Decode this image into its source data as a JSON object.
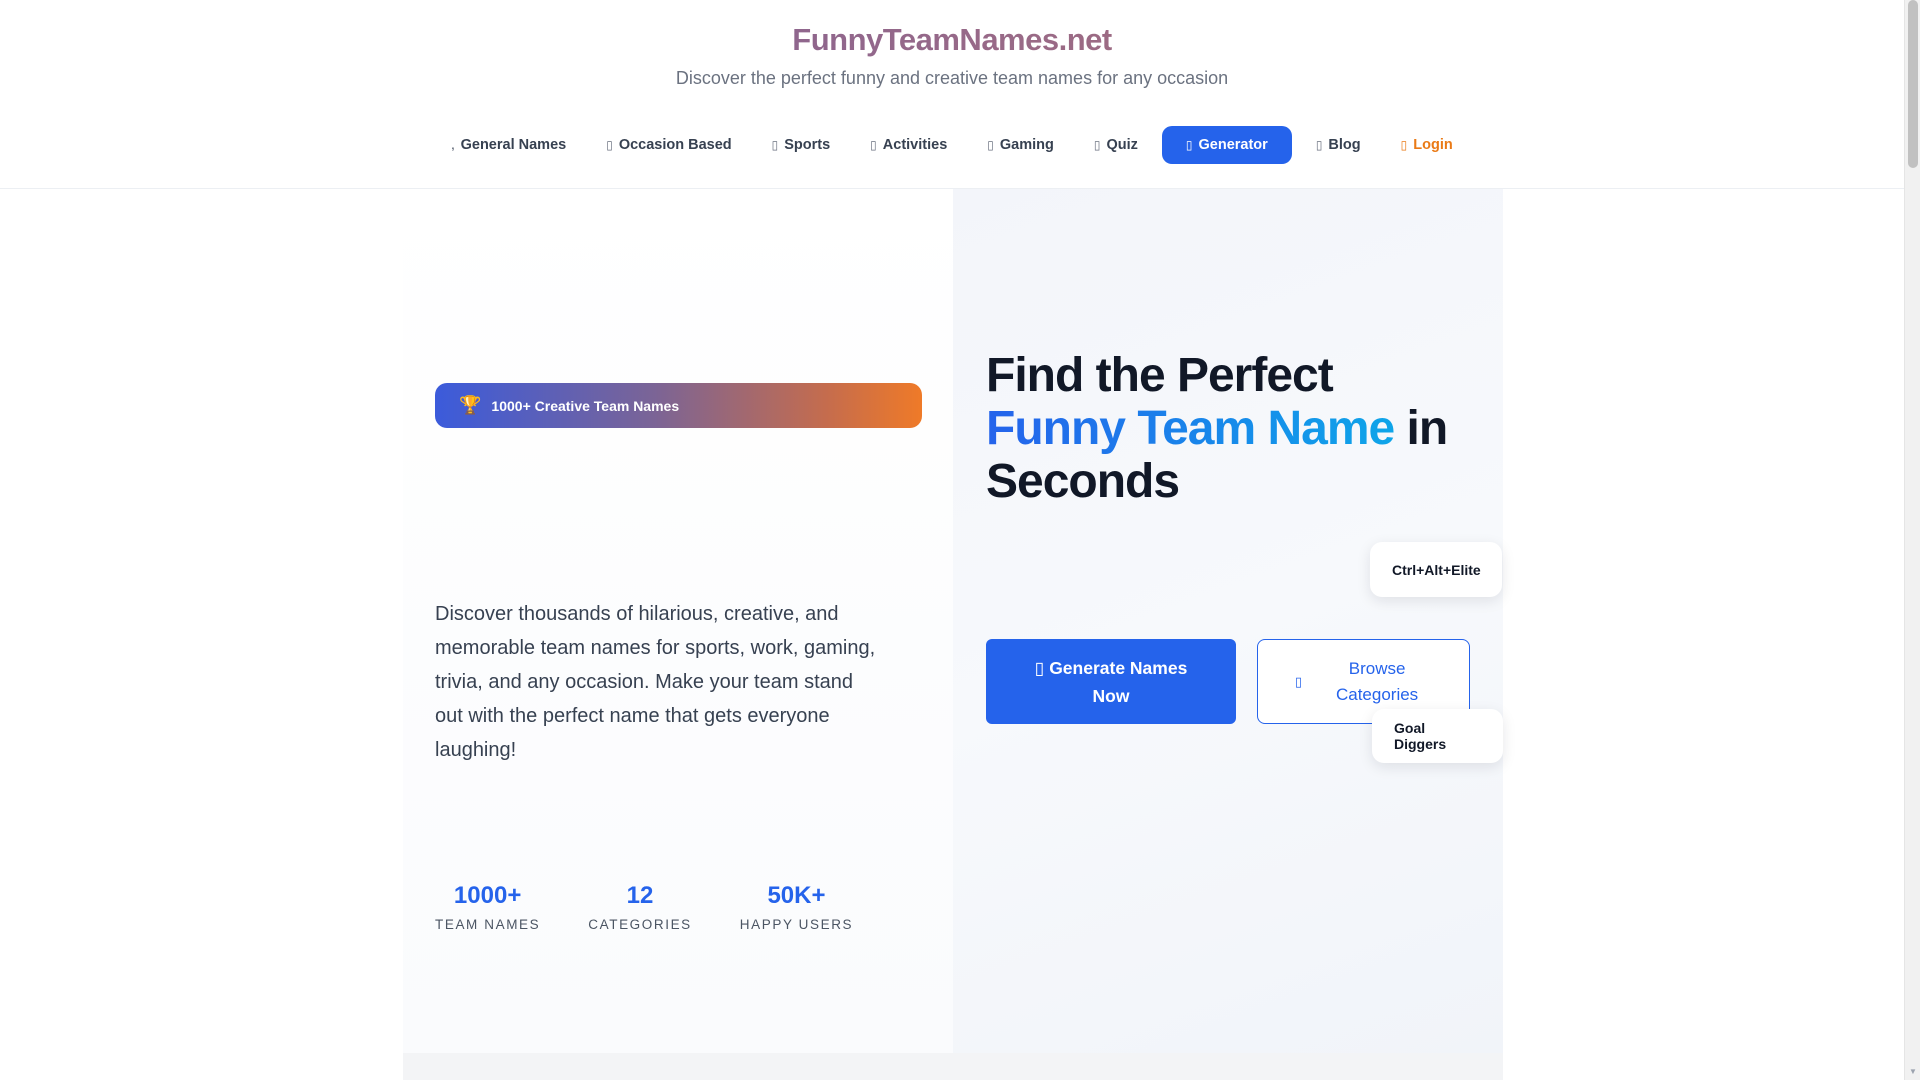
{
  "header": {
    "brand": "FunnyTeamNames.net",
    "tagline": "Discover the perfect funny and creative team names for any occasion"
  },
  "nav": {
    "items": [
      {
        "label": "General Names",
        "icon": "list-icon",
        "glyph": "‚"
      },
      {
        "label": "Occasion Based",
        "icon": "calendar-icon",
        "glyph": "▯"
      },
      {
        "label": "Sports",
        "icon": "ball-icon",
        "glyph": "▯"
      },
      {
        "label": "Activities",
        "icon": "activity-icon",
        "glyph": "▯"
      },
      {
        "label": "Gaming",
        "icon": "gamepad-icon",
        "glyph": "▯"
      },
      {
        "label": "Quiz",
        "icon": "question-icon",
        "glyph": "▯"
      },
      {
        "label": "Generator",
        "icon": "magic-icon",
        "glyph": "▯"
      },
      {
        "label": "Blog",
        "icon": "blog-icon",
        "glyph": "▯"
      },
      {
        "label": "Login",
        "icon": "login-icon",
        "glyph": "▯"
      }
    ],
    "active_item": "Generator",
    "accent_color": "#2563eb",
    "login_color": "#ea7a16"
  },
  "hero": {
    "badge_icon": "🏆",
    "badge_text": "1000+ Creative Team Names",
    "headline_part1": "Find the Perfect ",
    "headline_highlight": "Funny Team Name",
    "headline_part2": " in Seconds",
    "description": "Discover thousands of hilarious, creative, and memorable team names for sports, work, gaming, trivia, and any occasion. Make your team stand out with the perfect name that gets everyone laughing!",
    "primary_button_icon": "▯",
    "primary_button": "Generate Names Now",
    "secondary_button_icon": "▯",
    "secondary_button": "Browse Categories",
    "floating_cards": [
      "Ctrl+Alt+Elite",
      "Goal Diggers"
    ],
    "stats": [
      {
        "value": "1000+",
        "label": "TEAM NAMES"
      },
      {
        "value": "12",
        "label": "CATEGORIES"
      },
      {
        "value": "50K+",
        "label": "HAPPY USERS"
      }
    ]
  }
}
